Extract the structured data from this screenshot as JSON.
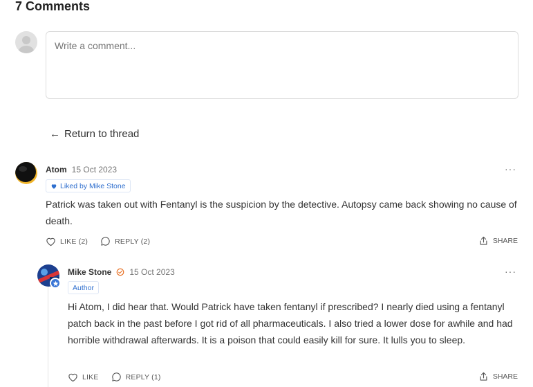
{
  "heading": "7 Comments",
  "composer": {
    "placeholder": "Write a comment..."
  },
  "return_link": {
    "arrow": "←",
    "label": "Return to thread"
  },
  "comments": [
    {
      "author": "Atom",
      "date": "15 Oct 2023",
      "liked_badge": "Liked by Mike Stone",
      "text": "Patrick was taken out with Fentanyl is the suspicion by the detective. Autopsy came back showing no cause of death.",
      "like_label": "LIKE (2)",
      "reply_label": "REPLY (2)",
      "share_label": "SHARE",
      "more": "···"
    },
    {
      "author": "Mike Stone",
      "date": "15 Oct 2023",
      "role_badge": "Author",
      "text": "Hi Atom, I did hear that. Would Patrick have taken fentanyl if prescribed? I nearly died using a fentanyl patch back in the past before I got rid of all pharmaceuticals. I also tried a lower dose for awhile and had horrible withdrawal afterwards. It is a poison that could easily kill for sure. It lulls you to sleep.",
      "like_label": "LIKE",
      "reply_label": "REPLY (1)",
      "share_label": "SHARE",
      "more": "···"
    }
  ],
  "icons": {
    "heart": "heart-icon",
    "like": "heart-outline-icon",
    "reply": "speech-bubble-icon",
    "share": "share-icon",
    "verified": "check-circle-icon",
    "star": "star-icon"
  },
  "colors": {
    "accent": "#2f6fce",
    "verified": "#e8742a"
  }
}
